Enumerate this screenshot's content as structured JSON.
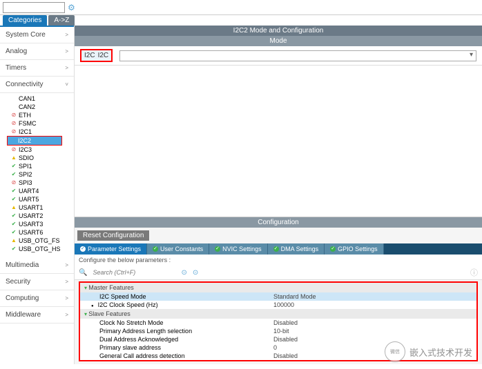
{
  "topbar": {
    "search_placeholder": ""
  },
  "tabs": {
    "categories": "Categories",
    "az": "A->Z"
  },
  "sidebar": {
    "groups": [
      {
        "label": "System Core",
        "chev": ">"
      },
      {
        "label": "Analog",
        "chev": ">"
      },
      {
        "label": "Timers",
        "chev": ">"
      },
      {
        "label": "Connectivity",
        "chev": "˅",
        "expanded": true
      },
      {
        "label": "Multimedia",
        "chev": ">"
      },
      {
        "label": "Security",
        "chev": ">"
      },
      {
        "label": "Computing",
        "chev": ">"
      },
      {
        "label": "Middleware",
        "chev": ">"
      }
    ],
    "conn_items": [
      {
        "icon": "none",
        "label": "CAN1"
      },
      {
        "icon": "none",
        "label": "CAN2"
      },
      {
        "icon": "red",
        "label": "ETH"
      },
      {
        "icon": "red",
        "label": "FSMC"
      },
      {
        "icon": "red",
        "label": "I2C1"
      },
      {
        "icon": "none",
        "label": "I2C2",
        "selected": true
      },
      {
        "icon": "red",
        "label": "I2C3"
      },
      {
        "icon": "yellow",
        "label": "SDIO"
      },
      {
        "icon": "green",
        "label": "SPI1"
      },
      {
        "icon": "green",
        "label": "SPI2"
      },
      {
        "icon": "red",
        "label": "SPI3"
      },
      {
        "icon": "green",
        "label": "UART4"
      },
      {
        "icon": "green",
        "label": "UART5"
      },
      {
        "icon": "yellow",
        "label": "USART1"
      },
      {
        "icon": "green",
        "label": "USART2"
      },
      {
        "icon": "green",
        "label": "USART3"
      },
      {
        "icon": "green",
        "label": "USART6"
      },
      {
        "icon": "yellow",
        "label": "USB_OTG_FS"
      },
      {
        "icon": "green",
        "label": "USB_OTG_HS"
      }
    ]
  },
  "content": {
    "title": "I2C2 Mode and Configuration",
    "mode_header": "Mode",
    "mode_label": "I2C",
    "mode_value": "I2C",
    "config_header": "Configuration",
    "reset_btn": "Reset Configuration",
    "config_tabs": [
      "Parameter Settings",
      "User Constants",
      "NVIC Settings",
      "DMA Settings",
      "GPIO Settings"
    ],
    "config_hint": "Configure the below parameters :",
    "search_placeholder": "Search (Ctrl+F)",
    "params": {
      "master_label": "Master Features",
      "slave_label": "Slave Features",
      "rows_master": [
        {
          "label": "I2C Speed Mode",
          "value": "Standard Mode",
          "selected": true
        },
        {
          "label": "I2C Clock Speed (Hz)",
          "value": "100000",
          "bullet": true
        }
      ],
      "rows_slave": [
        {
          "label": "Clock No Stretch Mode",
          "value": "Disabled"
        },
        {
          "label": "Primary Address Length selection",
          "value": "10-bit"
        },
        {
          "label": "Dual Address Acknowledged",
          "value": "Disabled"
        },
        {
          "label": "Primary slave address",
          "value": "0"
        },
        {
          "label": "General Call address detection",
          "value": "Disabled"
        }
      ]
    }
  },
  "watermark": "嵌入式技术开发"
}
